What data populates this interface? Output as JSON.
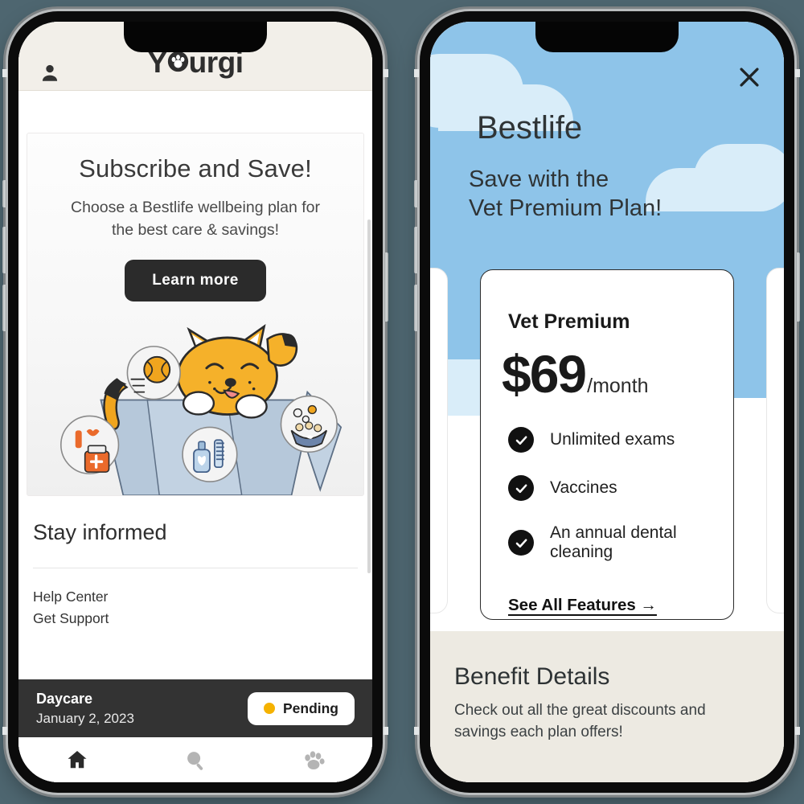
{
  "background_color": "#4e6670",
  "left_phone": {
    "header": {
      "logo_text": "Yourgi",
      "avatar_icon": "person-icon"
    },
    "promo": {
      "title": "Subscribe and Save!",
      "subtitle": "Choose a Bestlife wellbeing plan for the best care & savings!",
      "cta_label": "Learn more",
      "illustration": "cat-in-bag-with-pet-supplies"
    },
    "stay_informed": {
      "title": "Stay informed",
      "links": [
        "Help Center",
        "Get Support"
      ]
    },
    "status_strip": {
      "service": "Daycare",
      "date": "January 2, 2023",
      "badge_label": "Pending",
      "badge_dot_color": "#f5b200"
    },
    "tabbar": [
      {
        "icon": "home-icon",
        "active": true
      },
      {
        "icon": "search-icon",
        "active": false
      },
      {
        "icon": "paw-icon",
        "active": false
      }
    ]
  },
  "right_phone": {
    "close_icon": "close-icon",
    "brand": "Bestlife",
    "headline_line1": "Save with the",
    "headline_line2": "Vet Premium Plan!",
    "sky_color": "#8ec4e9",
    "cloud_color": "#d9edf9",
    "plan_card": {
      "name": "Vet Premium",
      "price": "$69",
      "period": "/month",
      "features": [
        "Unlimited exams",
        "Vaccines",
        "An annual dental cleaning"
      ],
      "link_label": "See All Features →"
    },
    "benefits": {
      "title": "Benefit Details",
      "subtitle": "Check out all the great discounts and savings each plan offers!",
      "background_color": "#edeae2"
    }
  }
}
